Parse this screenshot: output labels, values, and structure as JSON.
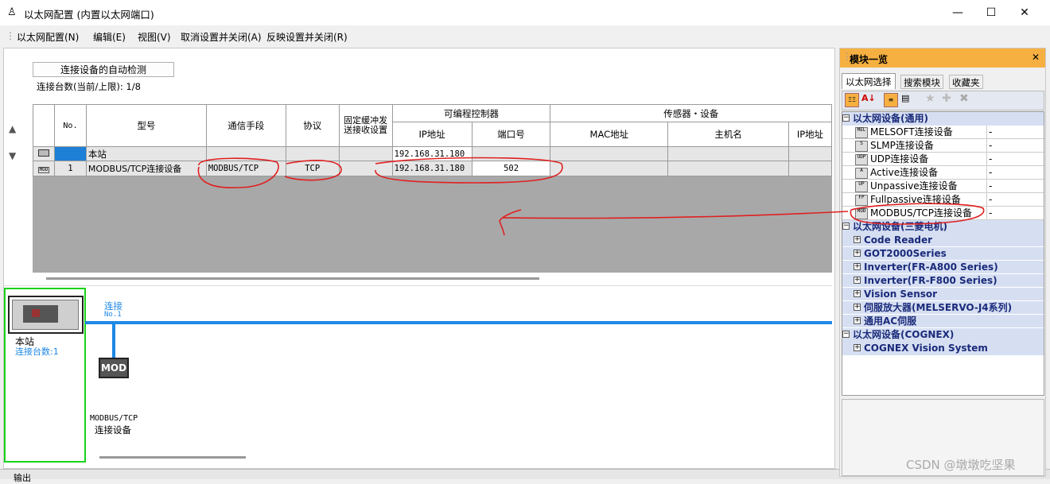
{
  "window": {
    "title": "以太网配置 (内置以太网端口)",
    "minimize": "—",
    "maximize": "☐",
    "close": "✕"
  },
  "menu": [
    "以太网配置(N)",
    "编辑(E)",
    "视图(V)",
    "取消设置并关闭(A)",
    "反映设置并关闭(R)"
  ],
  "toolbar": {
    "autodetect_label": "连接设备的自动检测",
    "count_label": "连接台数(当前/上限):  1/8"
  },
  "grid": {
    "headers": {
      "no": "No.",
      "model": "型号",
      "comm": "通信手段",
      "protocol": "协议",
      "fixed_buffer": "固定缓冲发",
      "fixed_buffer2": "送接收设置",
      "plc_group": "可编程控制器",
      "ip": "IP地址",
      "port": "端口号",
      "sensor_group": "传感器・设备",
      "mac": "MAC地址",
      "host": "主机名",
      "sensor_ip": "IP地址"
    },
    "rows": [
      {
        "icon": "station",
        "no": "",
        "model": "本站",
        "comm": "",
        "protocol": "",
        "ip": "192.168.31.180",
        "port": ""
      },
      {
        "icon": "MOD",
        "no": "1",
        "model": "MODBUS/TCP连接设备",
        "comm": "MODBUS/TCP",
        "protocol": "TCP",
        "ip": "192.168.31.180",
        "port": "502"
      }
    ]
  },
  "diagram": {
    "station_label": "本站",
    "station_count": "连接台数:1",
    "link_label": "连接",
    "link_no": "No.1",
    "device_icon_text": "MOD",
    "device_label_1": "MODBUS/TCP",
    "device_label_2": "连接设备"
  },
  "module_list": {
    "title": "模块一览",
    "close": "✕",
    "tabs": [
      "以太网选择",
      "搜索模块",
      "收藏夹"
    ],
    "categories": [
      {
        "label": "以太网设备(通用)",
        "expanded": true,
        "items": [
          {
            "icon": "MEL",
            "label": "MELSOFT连接设备",
            "value": "-"
          },
          {
            "icon": "S",
            "label": "SLMP连接设备",
            "value": "-"
          },
          {
            "icon": "UDP",
            "label": "UDP连接设备",
            "value": "-"
          },
          {
            "icon": "A",
            "label": "Active连接设备",
            "value": "-"
          },
          {
            "icon": "UP",
            "label": "Unpassive连接设备",
            "value": "-"
          },
          {
            "icon": "FP",
            "label": "Fullpassive连接设备",
            "value": "-"
          },
          {
            "icon": "MOD",
            "label": "MODBUS/TCP连接设备",
            "value": "-"
          }
        ]
      },
      {
        "label": "以太网设备(三菱电机)",
        "expanded": true,
        "subs": [
          "Code Reader",
          "GOT2000Series",
          "Inverter(FR-A800 Series)",
          "Inverter(FR-F800 Series)",
          "Vision Sensor",
          "伺服放大器(MELSERVO-J4系列)",
          "通用AC伺服"
        ]
      },
      {
        "label": "以太网设备(COGNEX)",
        "expanded": true,
        "subs": [
          "COGNEX Vision System"
        ]
      }
    ]
  },
  "bottom": {
    "output_label": "输出"
  },
  "watermark": "CSDN @墩墩吃坚果",
  "colors": {
    "accent_blue": "#1e88e5",
    "selection_blue": "#1e7fd6",
    "panel_orange": "#f6b042",
    "green_frame": "#19d319",
    "annotation_red": "#e02020"
  }
}
